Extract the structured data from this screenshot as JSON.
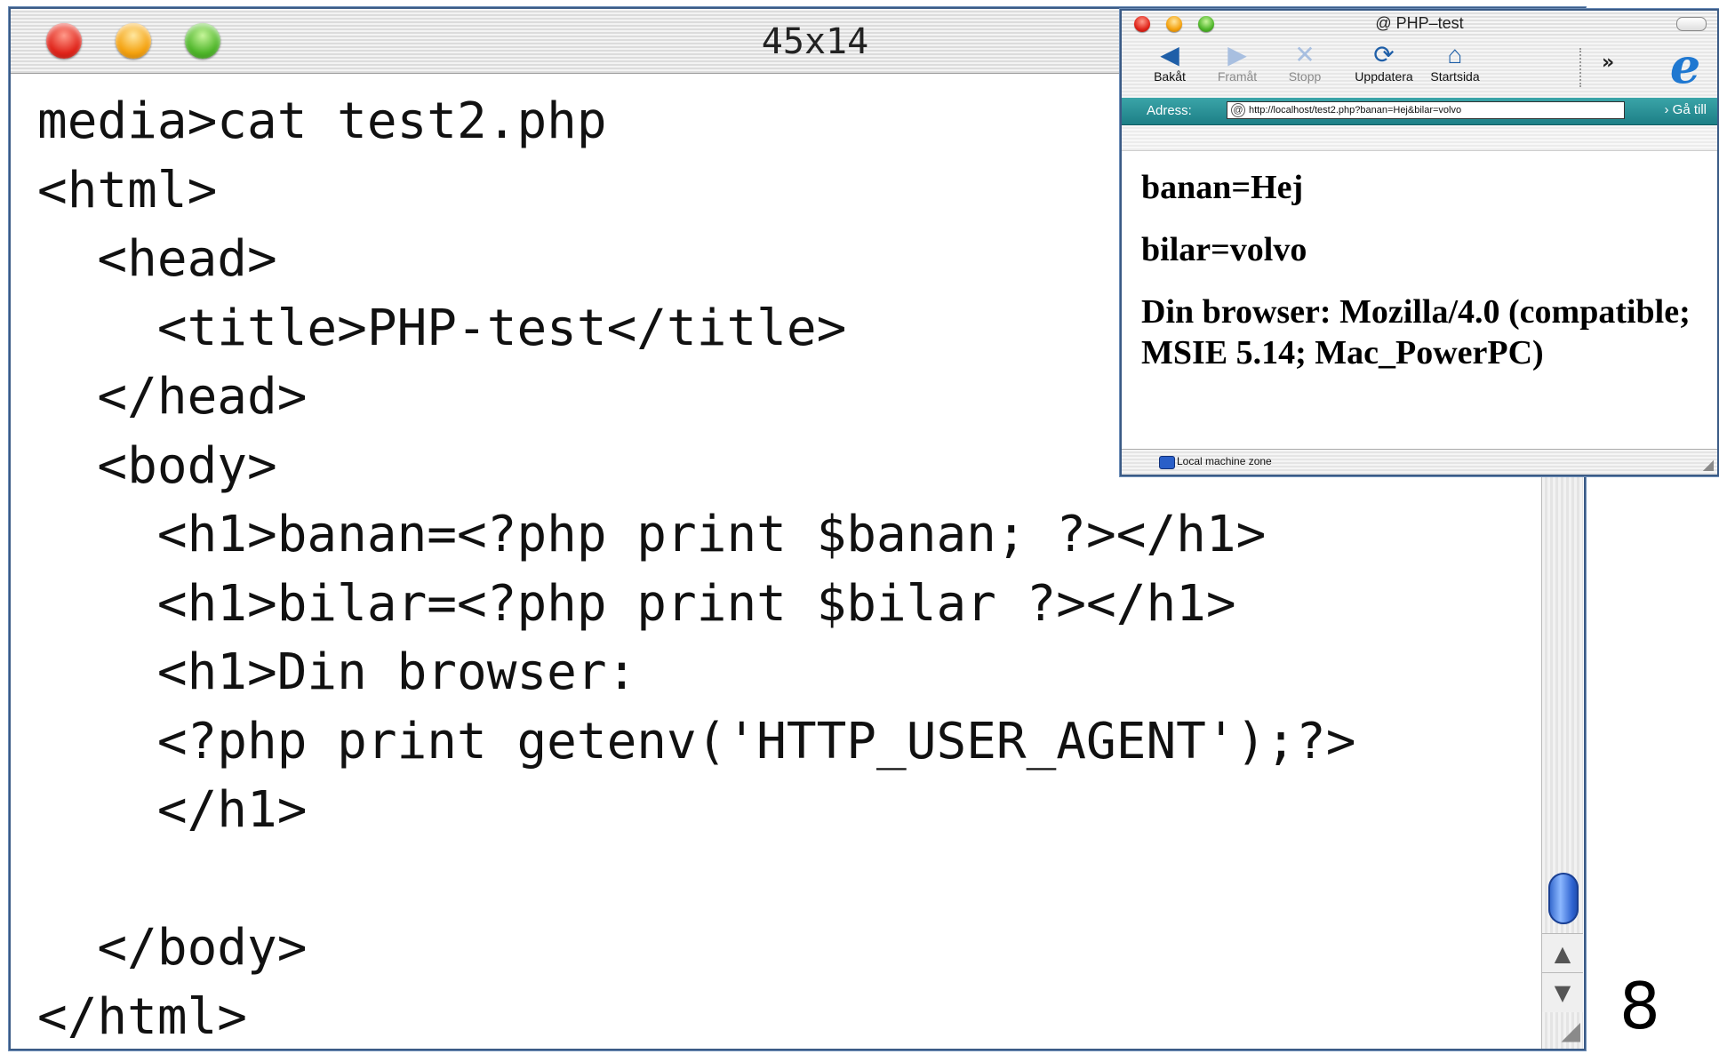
{
  "terminal": {
    "title": "45x14",
    "lines": [
      "media>cat test2.php",
      "<html>",
      "  <head>",
      "    <title>PHP-test</title>",
      "  </head>",
      "  <body>",
      "    <h1>banan=<?php print $banan; ?></h1>",
      "    <h1>bilar=<?php print $bilar ?></h1>",
      "    <h1>Din browser:",
      "    <?php print getenv('HTTP_USER_AGENT');?>",
      "    </h1>",
      "",
      "  </body>",
      "</html>"
    ]
  },
  "browser": {
    "title": "@ PHP–test",
    "toolbar": {
      "back": "Bakåt",
      "forward": "Framåt",
      "stop": "Stopp",
      "refresh": "Uppdatera",
      "home": "Startsida",
      "more": "»"
    },
    "address": {
      "label": "Adress:",
      "value": "http://localhost/test2.php?banan=Hej&bilar=volvo",
      "go": "› Gå till"
    },
    "content": {
      "h1_1": "banan=Hej",
      "h1_2": "bilar=volvo",
      "h1_3": "Din browser: Mozilla/4.0 (compatible; MSIE 5.14; Mac_PowerPC)"
    },
    "status": "Local machine zone"
  },
  "slide_number": "8"
}
